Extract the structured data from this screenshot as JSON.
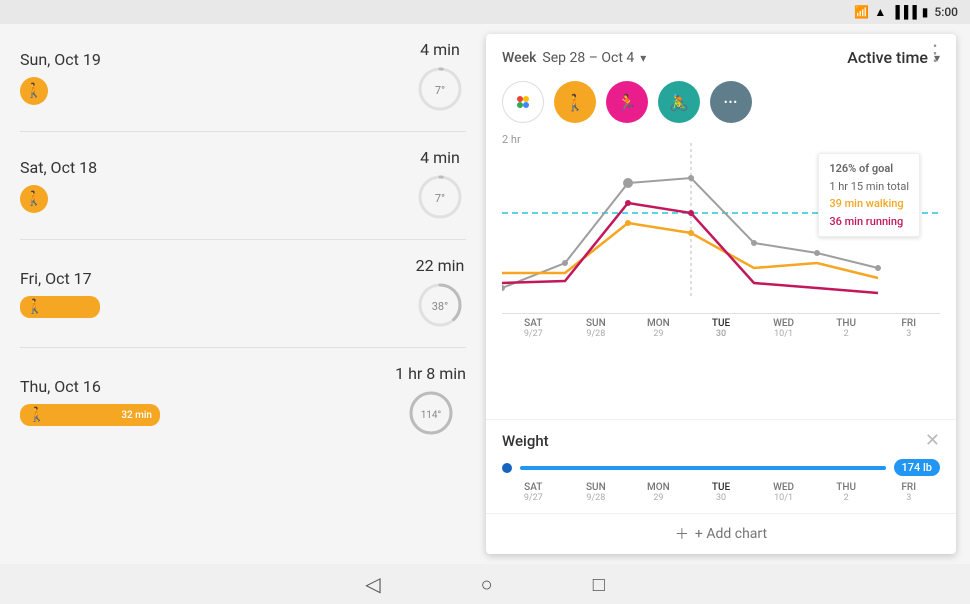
{
  "statusBar": {
    "time": "5:00",
    "icons": [
      "bluetooth",
      "wifi",
      "signal",
      "battery"
    ]
  },
  "header": {
    "threeDotsLabel": "⋮"
  },
  "activityList": {
    "items": [
      {
        "date": "Sun, Oct 19",
        "duration": "4 min",
        "circlePercent": 7,
        "circleLabel": "7°",
        "hasProgressBar": false,
        "hasWalkIcon": true
      },
      {
        "date": "Sat, Oct 18",
        "duration": "4 min",
        "circlePercent": 7,
        "circleLabel": "7°",
        "hasProgressBar": false,
        "hasWalkIcon": true
      },
      {
        "date": "Fri, Oct 17",
        "duration": "22 min",
        "circlePercent": 38,
        "circleLabel": "38°",
        "hasProgressBar": true,
        "progressWidth": 60,
        "hasWalkIcon": true
      },
      {
        "date": "Thu, Oct 16",
        "duration": "1 hr 8 min",
        "circlePercent": 114,
        "circleLabel": "114°",
        "hasProgressBar": true,
        "progressWidth": 120,
        "progressLabel": "32 min",
        "hasWalkIcon": true
      }
    ]
  },
  "chartCard": {
    "weekLabel": "Week",
    "weekRange": "Sep 28 – Oct 4",
    "activeTimeLabel": "Active time",
    "yLabel": "2 hr",
    "activityTypes": [
      {
        "name": "google",
        "icon": "⬡",
        "color": "white"
      },
      {
        "name": "walk",
        "icon": "🚶",
        "color": "#f5a623"
      },
      {
        "name": "run",
        "icon": "🏃",
        "color": "#e91e8c"
      },
      {
        "name": "bike",
        "icon": "🚴",
        "color": "#26a69a"
      },
      {
        "name": "more",
        "icon": "•••",
        "color": "#607d8b"
      }
    ],
    "tooltip": {
      "goal": "126% of goal",
      "total": "1 hr 15 min total",
      "walking": "39 min walking",
      "running": "36 min running"
    },
    "xLabels": [
      {
        "main": "SAT",
        "sub": "9/27"
      },
      {
        "main": "SUN",
        "sub": "9/28"
      },
      {
        "main": "MON",
        "sub": "29"
      },
      {
        "main": "TUE",
        "sub": "30"
      },
      {
        "main": "WED",
        "sub": "10/1"
      },
      {
        "main": "THU",
        "sub": "2"
      },
      {
        "main": "FRI",
        "sub": "3"
      }
    ],
    "weight": {
      "title": "Weight",
      "value": "174 lb"
    },
    "addChart": "+ Add chart"
  },
  "bottomNav": {
    "back": "◁",
    "home": "○",
    "recents": "□"
  }
}
